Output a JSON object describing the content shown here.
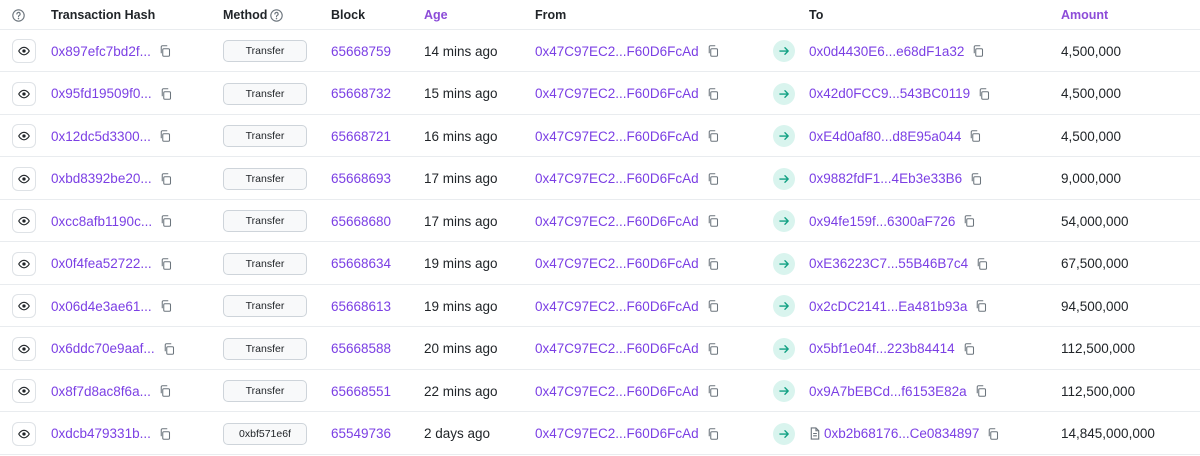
{
  "header": {
    "hash": "Transaction Hash",
    "method": "Method",
    "block": "Block",
    "age": "Age",
    "from": "From",
    "to": "To",
    "amount": "Amount"
  },
  "colors": {
    "link": "#7b3fe4",
    "accent": "#8c4cd8",
    "arrow_bg": "#d9f4ee",
    "arrow": "#11a083"
  },
  "rows": [
    {
      "hash": "0x897efc7bd2f...",
      "method": "Transfer",
      "block": "65668759",
      "age": "14 mins ago",
      "from": "0x47C97EC2...F60D6FcAd",
      "to": "0x0d4430E6...e68dF1a32",
      "amount": "4,500,000",
      "to_contract": false
    },
    {
      "hash": "0x95fd19509f0...",
      "method": "Transfer",
      "block": "65668732",
      "age": "15 mins ago",
      "from": "0x47C97EC2...F60D6FcAd",
      "to": "0x42d0FCC9...543BC0119",
      "amount": "4,500,000",
      "to_contract": false
    },
    {
      "hash": "0x12dc5d3300...",
      "method": "Transfer",
      "block": "65668721",
      "age": "16 mins ago",
      "from": "0x47C97EC2...F60D6FcAd",
      "to": "0xE4d0af80...d8E95a044",
      "amount": "4,500,000",
      "to_contract": false
    },
    {
      "hash": "0xbd8392be20...",
      "method": "Transfer",
      "block": "65668693",
      "age": "17 mins ago",
      "from": "0x47C97EC2...F60D6FcAd",
      "to": "0x9882fdF1...4Eb3e33B6",
      "amount": "9,000,000",
      "to_contract": false
    },
    {
      "hash": "0xcc8afb1190c...",
      "method": "Transfer",
      "block": "65668680",
      "age": "17 mins ago",
      "from": "0x47C97EC2...F60D6FcAd",
      "to": "0x94fe159f...6300aF726",
      "amount": "54,000,000",
      "to_contract": false
    },
    {
      "hash": "0x0f4fea52722...",
      "method": "Transfer",
      "block": "65668634",
      "age": "19 mins ago",
      "from": "0x47C97EC2...F60D6FcAd",
      "to": "0xE36223C7...55B46B7c4",
      "amount": "67,500,000",
      "to_contract": false
    },
    {
      "hash": "0x06d4e3ae61...",
      "method": "Transfer",
      "block": "65668613",
      "age": "19 mins ago",
      "from": "0x47C97EC2...F60D6FcAd",
      "to": "0x2cDC2141...Ea481b93a",
      "amount": "94,500,000",
      "to_contract": false
    },
    {
      "hash": "0x6ddc70e9aaf...",
      "method": "Transfer",
      "block": "65668588",
      "age": "20 mins ago",
      "from": "0x47C97EC2...F60D6FcAd",
      "to": "0x5bf1e04f...223b84414",
      "amount": "112,500,000",
      "to_contract": false
    },
    {
      "hash": "0x8f7d8ac8f6a...",
      "method": "Transfer",
      "block": "65668551",
      "age": "22 mins ago",
      "from": "0x47C97EC2...F60D6FcAd",
      "to": "0x9A7bEBCd...f6153E82a",
      "amount": "112,500,000",
      "to_contract": false
    },
    {
      "hash": "0xdcb479331b...",
      "method": "0xbf571e6f",
      "block": "65549736",
      "age": "2 days ago",
      "from": "0x47C97EC2...F60D6FcAd",
      "to": "0xb2b68176...Ce0834897",
      "amount": "14,845,000,000",
      "to_contract": true
    }
  ]
}
